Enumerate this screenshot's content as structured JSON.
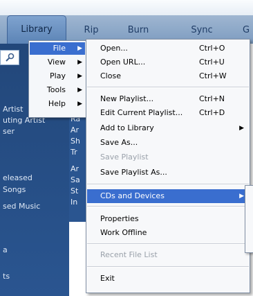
{
  "tabs": {
    "library": "Library",
    "rip": "Rip",
    "burn": "Burn",
    "sync": "Sync",
    "more": "G"
  },
  "nav": {
    "items": [
      "Artist",
      "uting Artist",
      "ser",
      "eleased",
      "Songs",
      "sed Music",
      "a",
      "ts"
    ]
  },
  "pane": {
    "partial": [
      "Ra",
      "Ar",
      "Sh",
      "Tr",
      "Ar",
      "Sa",
      "St",
      "In"
    ]
  },
  "menu_main": {
    "items": [
      {
        "label": "File",
        "selected": true,
        "submenu": true
      },
      {
        "label": "View",
        "submenu": true
      },
      {
        "label": "Play",
        "submenu": true
      },
      {
        "label": "Tools",
        "submenu": true
      },
      {
        "label": "Help",
        "submenu": true
      }
    ],
    "arrow": "▶"
  },
  "menu_file": {
    "open": {
      "label": "Open...",
      "shortcut": "Ctrl+O"
    },
    "open_url": {
      "label": "Open URL...",
      "shortcut": "Ctrl+U"
    },
    "close": {
      "label": "Close",
      "shortcut": "Ctrl+W"
    },
    "new_playlist": {
      "label": "New Playlist...",
      "shortcut": "Ctrl+N"
    },
    "edit_playlist": {
      "label": "Edit Current Playlist...",
      "shortcut": "Ctrl+D"
    },
    "add_library": {
      "label": "Add to Library"
    },
    "save_as": {
      "label": "Save As..."
    },
    "save_playlist": {
      "label": "Save Playlist",
      "disabled": true
    },
    "save_playlist_as": {
      "label": "Save Playlist As..."
    },
    "cds_devices": {
      "label": "CDs and Devices",
      "selected": true
    },
    "properties": {
      "label": "Properties"
    },
    "work_offline": {
      "label": "Work Offline"
    },
    "recent_files": {
      "label": "Recent File List",
      "disabled": true
    },
    "exit": {
      "label": "Exit"
    }
  },
  "colors": {
    "highlight": "#3a6ecf",
    "nav_bg": "#2a5590",
    "disabled_text": "#9aa1aa"
  }
}
